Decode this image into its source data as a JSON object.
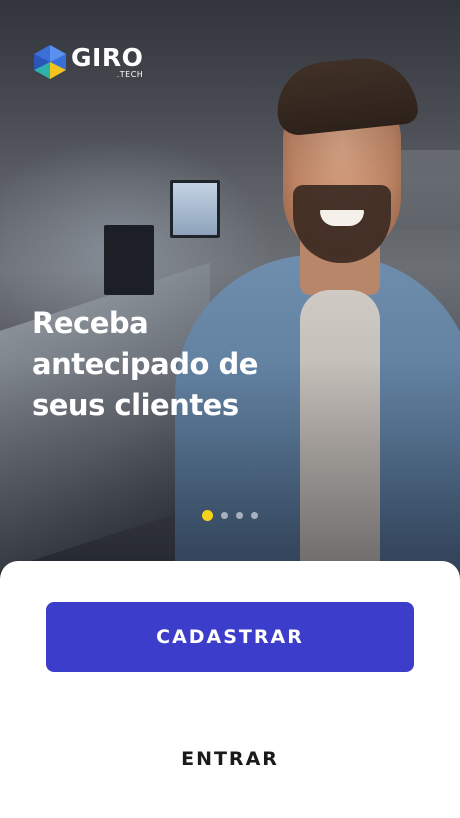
{
  "brand": {
    "name": "GIRO",
    "suffix": ".TECH",
    "logo_icon": "giro-logo-mark",
    "colors": {
      "logo_blue": "#3a6fd8",
      "logo_yellow": "#f3c51c",
      "logo_teal": "#2fb0a8"
    }
  },
  "carousel": {
    "headline": "Receba antecipado de seus clientes",
    "current_slide": 1,
    "total_slides": 4,
    "active_dot_color": "#f6d31a"
  },
  "actions": {
    "register_label": "CADASTRAR",
    "login_label": "ENTRAR",
    "primary_color": "#3d3dcc"
  }
}
